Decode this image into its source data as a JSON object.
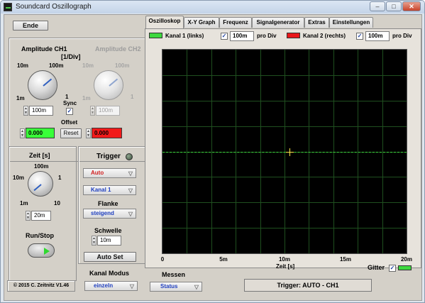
{
  "window": {
    "title": "Soundcard Oszillograph"
  },
  "left": {
    "ende_label": "Ende",
    "amp1": {
      "title": "Amplitude CH1",
      "unit": "[1/Div]",
      "ticks": {
        "tl": "10m",
        "tr": "100m",
        "bl": "1m",
        "br": "1"
      },
      "value": "100m"
    },
    "amp2": {
      "title": "Amplitude CH2",
      "ticks": {
        "tl": "10m",
        "tr": "100m",
        "bl": "1m",
        "br": "1"
      },
      "value": "100m"
    },
    "sync_label": "Sync",
    "sync_checked": "✓",
    "offset_label": "Offset",
    "offset1": "0.000",
    "offset2": "0.000",
    "reset_label": "Reset",
    "zeit": {
      "title": "Zeit [s]",
      "ticks": {
        "t": "100m",
        "l": "10m",
        "r": "1",
        "bl": "1m",
        "br": "10"
      },
      "value": "20m"
    },
    "runstop_label": "Run/Stop",
    "trigger": {
      "title": "Trigger",
      "mode": "Auto",
      "channel": "Kanal 1",
      "flanke_label": "Flanke",
      "flanke": "steigend",
      "schwelle_label": "Schwelle",
      "schwelle": "10m",
      "autoset_label": "Auto Set"
    },
    "copyright": "© 2015   C. Zeitnitz V1.46",
    "kanal_modus_label": "Kanal Modus",
    "kanal_modus": "einzeln"
  },
  "tabs": [
    "Oszilloskop",
    "X-Y Graph",
    "Frequenz",
    "Signalgenerator",
    "Extras",
    "Einstellungen"
  ],
  "active_tab": "Oszilloskop",
  "legend": {
    "ch1_label": "Kanal 1 (links)",
    "ch1_color": "#3ed83e",
    "ch1_check": "✓",
    "ch1_div": "100m",
    "ch1_unit": "pro Div",
    "ch2_label": "Kanal 2 (rechts)",
    "ch2_color": "#e8161a",
    "ch2_check": "✓",
    "ch2_div": "100m",
    "ch2_unit": "pro Div"
  },
  "plot": {
    "x_ticks": [
      "0",
      "5m",
      "10m",
      "15m",
      "20m"
    ],
    "x_label": "Zeit [s]",
    "gitter_label": "Gitter",
    "gitter_check": "✓",
    "gitter_color": "#3ed83e",
    "trace_color": "#3ed83e"
  },
  "chart_data": {
    "type": "line",
    "xlabel": "Zeit [s]",
    "ylabel": "",
    "xlim": [
      0,
      0.02
    ],
    "x_ticks": [
      "0",
      "5m",
      "10m",
      "15m",
      "20m"
    ],
    "grid": true,
    "series": [
      {
        "name": "Kanal 1 (links)",
        "x": [
          0,
          0.02
        ],
        "y": [
          0,
          0
        ]
      }
    ]
  },
  "bottom": {
    "messen_label": "Messen",
    "status_label": "Status",
    "trigger_status": "Trigger: AUTO - CH1"
  }
}
